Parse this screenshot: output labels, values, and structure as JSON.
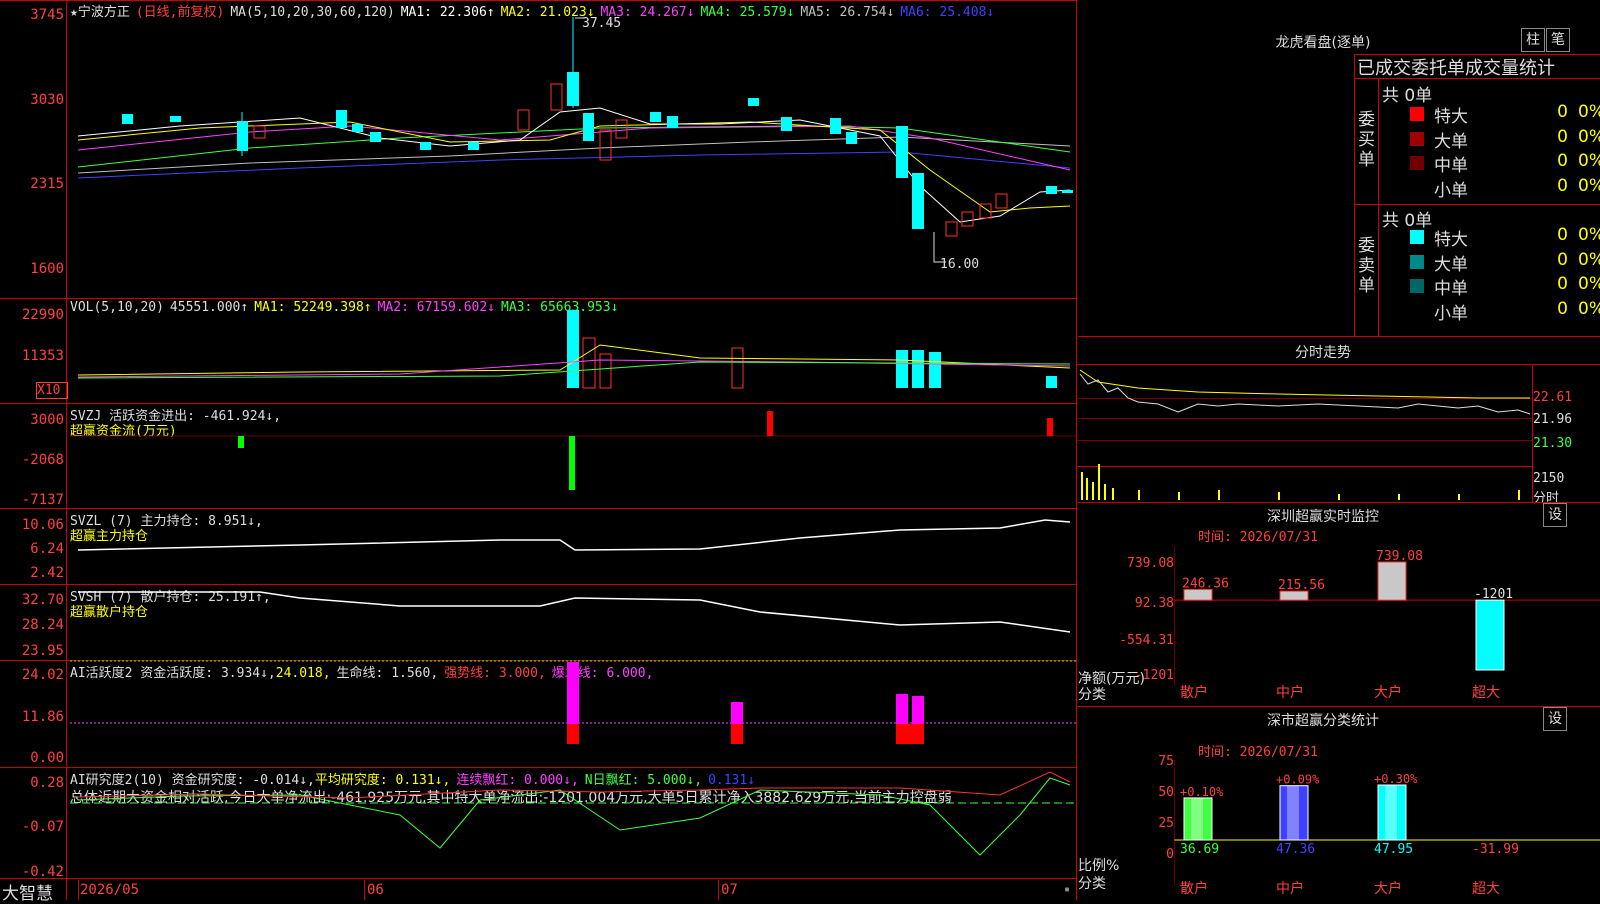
{
  "kline": {
    "title": "★宁波方正",
    "mode": "(日线,前复权)",
    "ma_label": "MA(5,10,20,30,60,120)",
    "ma": [
      {
        "label": "MA1: 22.306↑",
        "color": "#ffffff"
      },
      {
        "label": "MA2: 21.023↓",
        "color": "#ffff00"
      },
      {
        "label": "MA3: 24.267↓",
        "color": "#ff40ff"
      },
      {
        "label": "MA4: 25.579↓",
        "color": "#40ff40"
      },
      {
        "label": "MA5: 26.754↓",
        "color": "#c0c0c0"
      },
      {
        "label": "MA6: 25.408↓",
        "color": "#4040ff"
      }
    ],
    "yticks": [
      "3745",
      "3030",
      "2315",
      "1600"
    ],
    "hi_label": "37.45",
    "lo_label": "16.00"
  },
  "vol": {
    "legend_prefix": "VOL(5,10,20)",
    "value": "45551.000↑",
    "ma1": "MA1: 52249.398↑",
    "ma2": "MA2: 67159.602↓",
    "ma3": "MA3: 65663.953↓",
    "yticks": [
      "22990",
      "11353"
    ],
    "unit": "X10"
  },
  "svzj": {
    "legend": "SVZJ  活跃资金进出: -461.924↓,",
    "sub": "超赢资金流(万元)",
    "yticks": [
      "3000",
      "-2068",
      "-7137"
    ]
  },
  "svzl": {
    "legend": "SVZL (7) 主力持仓: 8.951↓,",
    "sub": "超赢主力持仓",
    "yticks": [
      "10.06",
      "6.24",
      "2.42"
    ]
  },
  "svsh": {
    "legend": "SVSH (7) 散户持仓: 25.191↑,",
    "sub": "超赢散户持仓",
    "yticks": [
      "32.70",
      "28.24",
      "23.95"
    ]
  },
  "ai1": {
    "prefix": "AI活跃度2 资金活跃度: 3.934↓,",
    "val2": "24.018,",
    "life": "生命线: 1.560,",
    "strong": "强势线: 3.000,",
    "burst": "爆发线: 6.000,",
    "yticks": [
      "24.02",
      "11.86",
      "0.00"
    ]
  },
  "ai2": {
    "prefix": "AI研究度2(10) 资金研究度: -0.014↓,",
    "avg": "平均研究度: 0.131↓,",
    "cont": "连续飘红: 0.000↓,",
    "nday": "N日飘红: 5.000↓,",
    "last": "0.131↓",
    "summary": "总体近期大资金相对活跃,今日大单净流出:-461.925万元,其中特大单净流出:-1201.004万元,大单5日累计净入3882.629万元,当前主力控盘弱",
    "yticks": [
      "0.28",
      "-0.07",
      "-0.42"
    ]
  },
  "axis": {
    "brand": "大智慧",
    "dates": [
      "2026/05",
      "06",
      "07"
    ]
  },
  "longhu": {
    "title": "龙虎看盘(逐单)",
    "btn1": "柱",
    "btn2": "笔",
    "header": "已成交委托单成交量统计",
    "buy_label": "委买单",
    "sell_label": "委卖单",
    "buy_total": "共 0单",
    "sell_total": "共 0单",
    "buy_rows": [
      {
        "name": "特大",
        "v": "0",
        "p": "0%",
        "color": "#ff0000"
      },
      {
        "name": "大单",
        "v": "0",
        "p": "0%",
        "color": "#a00000"
      },
      {
        "name": "中单",
        "v": "0",
        "p": "0%",
        "color": "#700000"
      },
      {
        "name": "小单",
        "v": "0",
        "p": "0%",
        "color": "#000000"
      }
    ],
    "sell_rows": [
      {
        "name": "特大",
        "v": "0",
        "p": "0%",
        "color": "#00ffff"
      },
      {
        "name": "大单",
        "v": "0",
        "p": "0%",
        "color": "#008888"
      },
      {
        "name": "中单",
        "v": "0",
        "p": "0%",
        "color": "#006666"
      },
      {
        "name": "小单",
        "v": "0",
        "p": "0%",
        "color": "#000000"
      }
    ]
  },
  "intraday": {
    "title": "分时走势",
    "yticks": [
      "22.61",
      "21.96",
      "21.30"
    ],
    "vol_ticks": [
      "2150",
      "分时"
    ]
  },
  "monitor": {
    "title": "深圳超赢实时监控",
    "btn": "设",
    "time": "时间: 2026/07/31",
    "yticks": [
      "739.08",
      "92.38",
      "-554.31",
      "-1201"
    ],
    "ylabel": "净额(万元)",
    "xlabel": "分类",
    "bars": [
      {
        "cat": "散户",
        "value": 246.36,
        "label": "246.36"
      },
      {
        "cat": "中户",
        "value": 215.56,
        "label": "215.56"
      },
      {
        "cat": "大户",
        "value": 739.08,
        "label": "739.08"
      },
      {
        "cat": "超大",
        "value": -1201,
        "label": "-1201"
      }
    ]
  },
  "classify": {
    "title": "深市超赢分类统计",
    "btn": "设",
    "time": "时间: 2026/07/31",
    "yticks": [
      "75",
      "50",
      "25",
      "0"
    ],
    "ylabel": "比例%",
    "xlabel": "分类",
    "bars": [
      {
        "cat": "散户",
        "value": 36.69,
        "top": "+0.10%",
        "bottom": "36.69",
        "color": "#40ff40"
      },
      {
        "cat": "中户",
        "value": 47.36,
        "top": "+0.09%",
        "bottom": "47.36",
        "color": "#4040ff"
      },
      {
        "cat": "大户",
        "value": 47.95,
        "top": "+0.30%",
        "bottom": "47.95",
        "color": "#00ffff"
      },
      {
        "cat": "超大",
        "value": -31.99,
        "top": "",
        "bottom": "-31.99",
        "color": "#ff4040"
      }
    ]
  }
}
